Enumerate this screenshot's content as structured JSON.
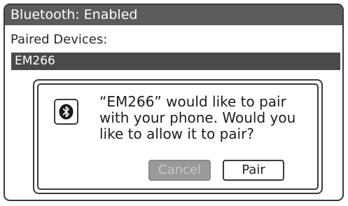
{
  "header": {
    "title": "Bluetooth: Enabled"
  },
  "paired_devices": {
    "label": "Paired Devices:",
    "items": [
      {
        "name": "EM266",
        "selected": true
      }
    ]
  },
  "dialog": {
    "icon": "bluetooth-icon",
    "message": "“EM266” would like to pair with your phone. Would you like to allow it to pair?",
    "buttons": {
      "cancel": {
        "label": "Cancel",
        "enabled": false
      },
      "pair": {
        "label": "Pair",
        "enabled": true
      }
    }
  },
  "colors": {
    "titlebar": "#5b5b5b",
    "selected_row": "#4a4a4a",
    "disabled_button": "#9a9a9a",
    "border": "#3a3a3a"
  }
}
